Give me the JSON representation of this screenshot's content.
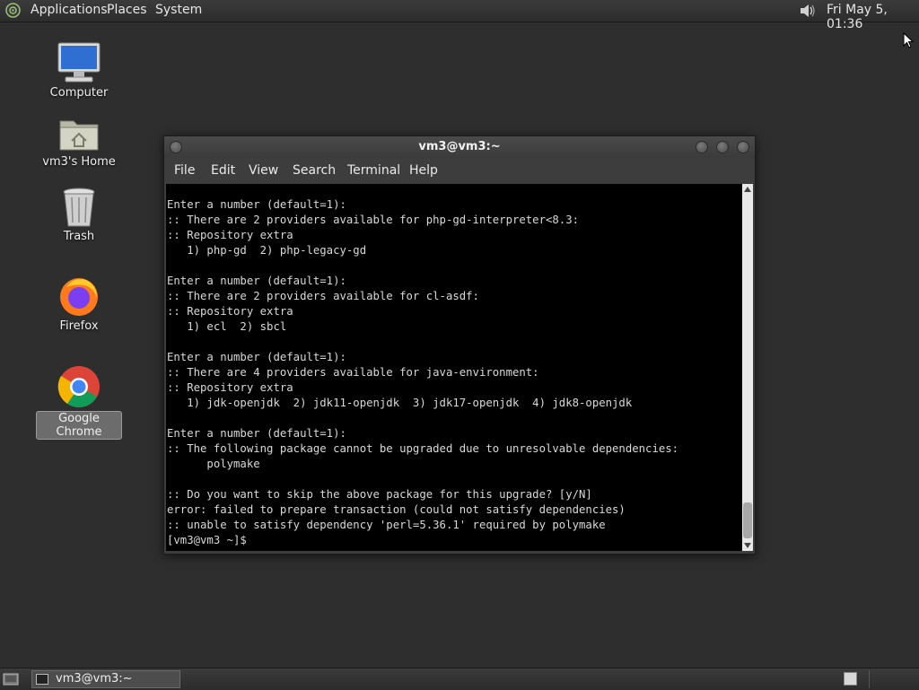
{
  "top_panel": {
    "menus": [
      "Applications",
      "Places",
      "System"
    ],
    "clock": "Fri May  5, 01:36",
    "distro_icon": "distro-logo-icon",
    "volume_icon": "speaker-icon"
  },
  "desktop_icons": [
    {
      "label": "Computer",
      "icon": "computer-icon"
    },
    {
      "label": "vm3's Home",
      "icon": "home-folder-icon"
    },
    {
      "label": "Trash",
      "icon": "trash-icon"
    },
    {
      "label": "Firefox",
      "icon": "firefox-icon"
    },
    {
      "label": "Google Chrome",
      "icon": "chrome-icon"
    }
  ],
  "terminal": {
    "title": "vm3@vm3:~",
    "menu": [
      "File",
      "Edit",
      "View",
      "Search",
      "Terminal",
      "Help"
    ],
    "lines": [
      "Enter a number (default=1):",
      ":: There are 2 providers available for php-gd-interpreter<8.3:",
      ":: Repository extra",
      "   1) php-gd  2) php-legacy-gd",
      "",
      "Enter a number (default=1):",
      ":: There are 2 providers available for cl-asdf:",
      ":: Repository extra",
      "   1) ecl  2) sbcl",
      "",
      "Enter a number (default=1):",
      ":: There are 4 providers available for java-environment:",
      ":: Repository extra",
      "   1) jdk-openjdk  2) jdk11-openjdk  3) jdk17-openjdk  4) jdk8-openjdk",
      "",
      "Enter a number (default=1):",
      ":: The following package cannot be upgraded due to unresolvable dependencies:",
      "      polymake",
      "",
      ":: Do you want to skip the above package for this upgrade? [y/N]",
      "error: failed to prepare transaction (could not satisfy dependencies)",
      ":: unable to satisfy dependency 'perl=5.36.1' required by polymake",
      "[vm3@vm3 ~]$"
    ]
  },
  "bottom_panel": {
    "task_label": "vm3@vm3:~"
  },
  "colors": {
    "desktop_bg": "#2d2e2d",
    "terminal_bg": "#000000",
    "terminal_fg": "#d9d9d9"
  }
}
